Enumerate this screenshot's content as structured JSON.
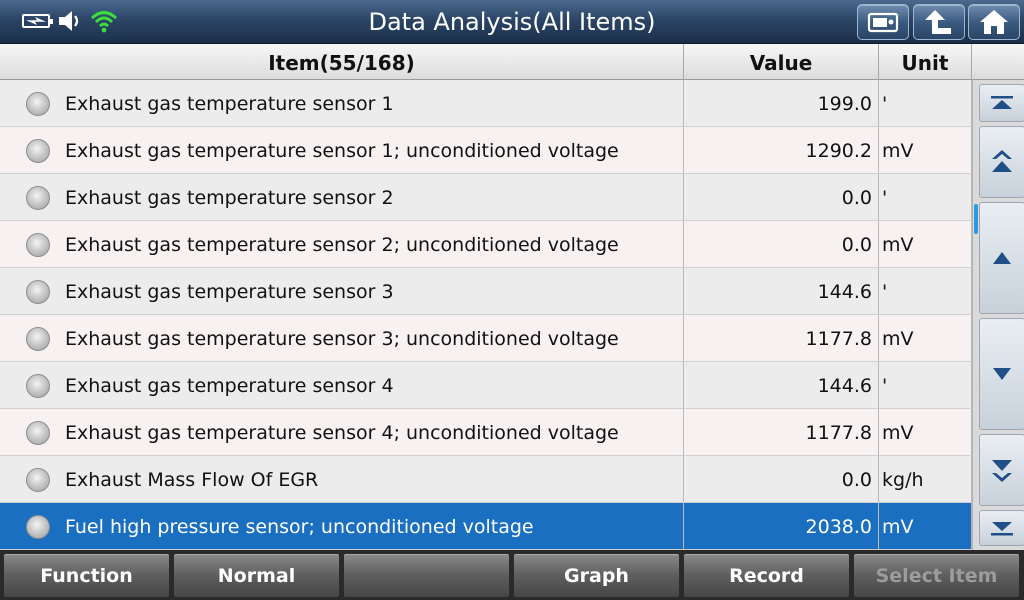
{
  "header": {
    "title": "Data Analysis(All Items)",
    "status_icons": [
      "battery-charging-icon",
      "speaker-icon",
      "wifi-icon"
    ],
    "buttons": [
      "screenshot-icon",
      "back-up-icon",
      "home-icon"
    ]
  },
  "table": {
    "columns": {
      "item": "Item(55/168)",
      "value": "Value",
      "unit": "Unit"
    },
    "rows": [
      {
        "name": "Exhaust gas temperature sensor 1",
        "value": "199.0",
        "unit": "'"
      },
      {
        "name": "Exhaust gas temperature sensor 1; unconditioned voltage",
        "value": "1290.2",
        "unit": "mV"
      },
      {
        "name": "Exhaust gas temperature sensor 2",
        "value": "0.0",
        "unit": "'"
      },
      {
        "name": "Exhaust gas temperature sensor 2; unconditioned voltage",
        "value": "0.0",
        "unit": "mV"
      },
      {
        "name": "Exhaust gas temperature sensor 3",
        "value": "144.6",
        "unit": "'"
      },
      {
        "name": "Exhaust gas temperature sensor 3; unconditioned voltage",
        "value": "1177.8",
        "unit": "mV"
      },
      {
        "name": "Exhaust gas temperature sensor 4",
        "value": "144.6",
        "unit": "'"
      },
      {
        "name": "Exhaust gas temperature sensor 4; unconditioned voltage",
        "value": "1177.8",
        "unit": "mV"
      },
      {
        "name": "Exhaust Mass Flow Of EGR",
        "value": "0.0",
        "unit": "kg/h"
      },
      {
        "name": "Fuel high pressure sensor; unconditioned voltage",
        "value": "2038.0",
        "unit": "mV"
      }
    ],
    "selected_index": 9
  },
  "scroll": {
    "buttons": [
      "scroll-top-icon",
      "page-up-icon",
      "line-up-icon",
      "line-down-icon",
      "page-down-icon",
      "scroll-bottom-icon"
    ]
  },
  "toolbar": {
    "function": "Function",
    "normal": "Normal",
    "empty": "",
    "graph": "Graph",
    "record": "Record",
    "select_item": "Select Item"
  },
  "colors": {
    "title_bar": "#2c4566",
    "selected_row": "#1a6fc0",
    "wifi": "#3cdc3c",
    "scroll_indicator": "#2a9be0"
  }
}
